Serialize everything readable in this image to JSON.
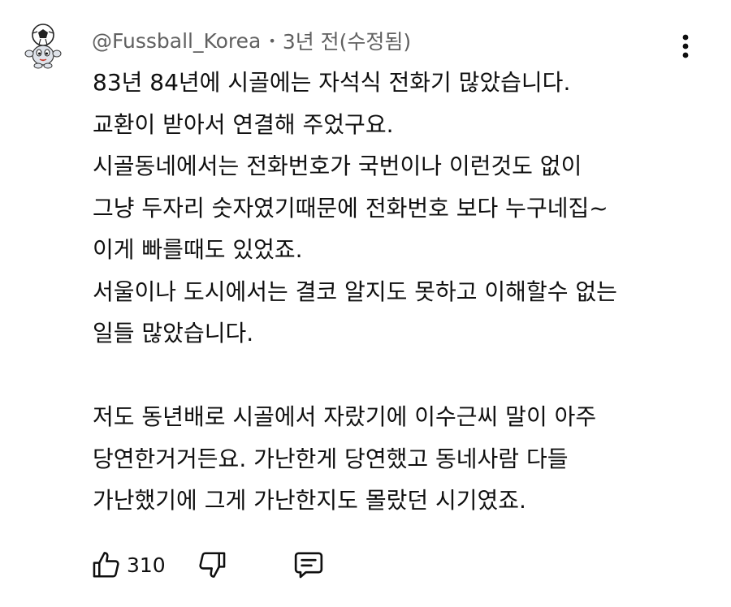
{
  "comment": {
    "author_handle": "@Fussball_Korea",
    "separator": "•",
    "timestamp": "3년 전(수정됨)",
    "paragraphs": [
      [
        "83년 84년에 시골에는 자석식 전화기 많았습니다.",
        "교환이 받아서 연결해 주었구요.",
        "시골동네에서는 전화번호가 국번이나 이런것도 없이",
        "그냥 두자리 숫자였기때문에 전화번호 보다 누구네집~",
        "이게 빠를때도 있었죠.",
        "서울이나 도시에서는 결코 알지도 못하고 이해할수 없는",
        "일들 많았습니다."
      ],
      [
        "저도 동년배로 시골에서 자랐기에 이수근씨 말이 아주",
        "당연한거거든요. 가난한게 당연했고 동네사람 다들",
        "가난했기에 그게 가난한지도 몰랐던 시기였죠."
      ]
    ],
    "like_count": "310"
  },
  "icons": {
    "avatar": "soccer-ball-mascot",
    "menu": "more-vertical-icon",
    "like": "thumbs-up-icon",
    "dislike": "thumbs-down-icon",
    "reply": "reply-comment-icon"
  },
  "colors": {
    "text_primary": "#0f0f0f",
    "text_secondary": "#606060",
    "background": "#ffffff"
  }
}
